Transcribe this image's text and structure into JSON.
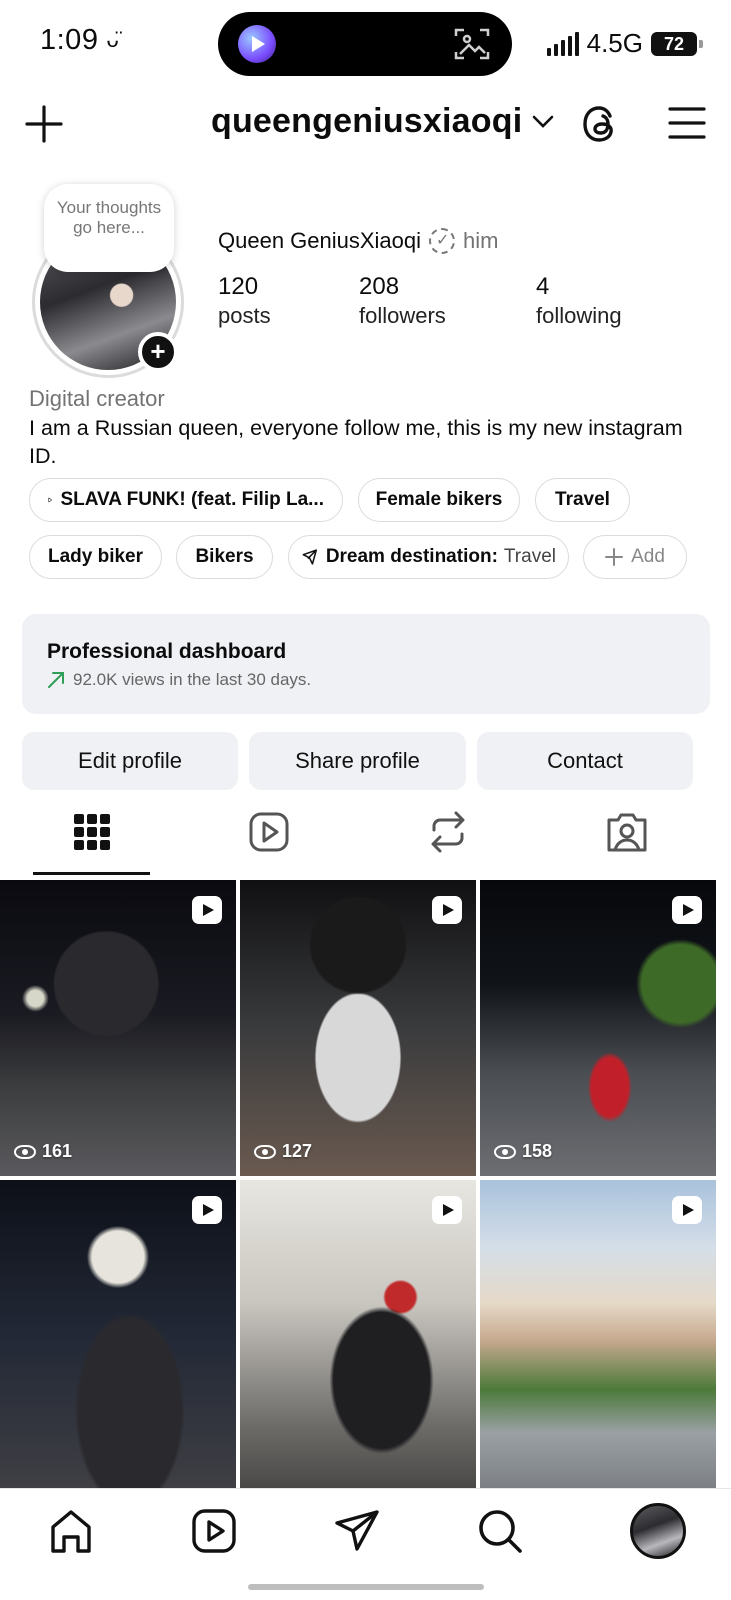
{
  "status_bar": {
    "time": "1:09",
    "network": "4.5G",
    "battery": "72"
  },
  "header": {
    "username": "queengeniusxiaoqi"
  },
  "profile": {
    "note_bubble": "Your thoughts go here...",
    "display_name": "Queen GeniusXiaoqi",
    "pronoun": "him",
    "stats": [
      {
        "value": "120",
        "label": "posts"
      },
      {
        "value": "208",
        "label": "followers"
      },
      {
        "value": "4",
        "label": "following"
      }
    ],
    "category": "Digital creator",
    "bio": "I am a Russian queen, everyone follow me, this is my new instagram ID."
  },
  "chips": {
    "music": "SLAVA FUNK! (feat. Filip La...",
    "female_bikers": "Female bikers",
    "travel": "Travel",
    "lady_biker": "Lady biker",
    "bikers": "Bikers",
    "dream_label": "Dream destination:",
    "dream_value": "Travel",
    "add": "Add"
  },
  "dashboard": {
    "title": "Professional dashboard",
    "subtitle": "92.0K views in the last 30 days."
  },
  "buttons": {
    "edit": "Edit profile",
    "share": "Share profile",
    "contact": "Contact"
  },
  "grid": {
    "items": [
      {
        "views": "161",
        "is_reel": true
      },
      {
        "views": "127",
        "is_reel": true
      },
      {
        "views": "158",
        "is_reel": true
      },
      {
        "views": "",
        "is_reel": true
      },
      {
        "views": "",
        "is_reel": true
      },
      {
        "views": "",
        "is_reel": true
      }
    ]
  },
  "icons": {
    "create": "plus-icon",
    "dropdown": "chevron-down-icon",
    "threads": "threads-icon",
    "menu": "hamburger-menu-icon",
    "tabs": [
      "grid-icon",
      "reels-icon",
      "reposts-icon",
      "tagged-icon"
    ],
    "nav": [
      "home-icon",
      "reels-icon",
      "send-icon",
      "search-icon",
      "profile-avatar"
    ]
  },
  "colors": {
    "accent_green": "#2f9e57",
    "button_bg": "#eff1f4",
    "text": "#0c0c0c"
  }
}
